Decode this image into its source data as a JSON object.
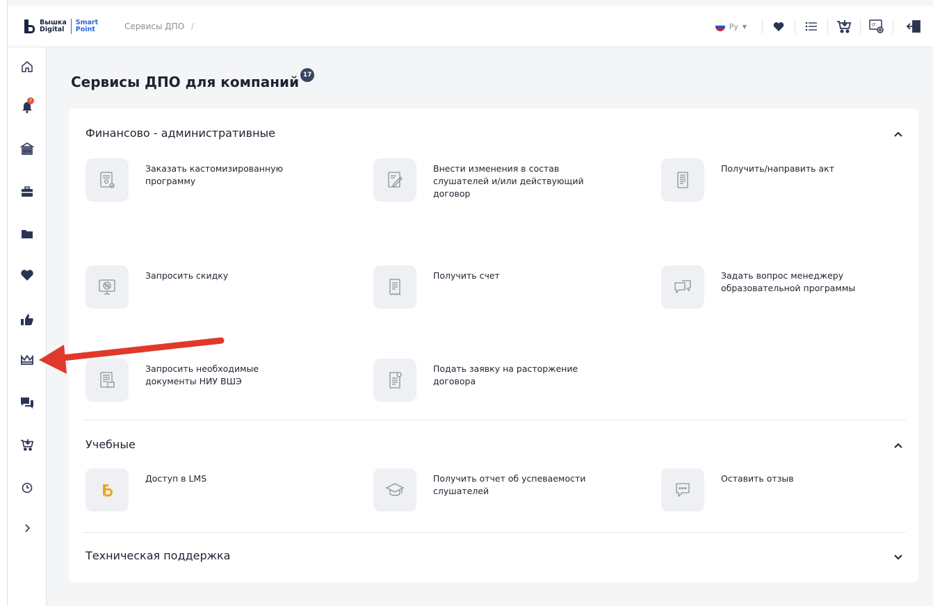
{
  "header": {
    "logo": {
      "line1": "Вышка",
      "line2": "Digital",
      "brand1": "Smart",
      "brand2": "Point"
    },
    "breadcrumb": {
      "current": "Сервисы ДПО",
      "separator": "/"
    },
    "language": "Ру",
    "icons": [
      "heart-icon",
      "list-icon",
      "cart-icon",
      "it-monitor-icon",
      "logout-icon"
    ]
  },
  "sidebar": {
    "notification_count": "2",
    "items": [
      "home-icon",
      "bell-icon",
      "university-icon",
      "briefcase-icon",
      "folder-icon",
      "heart-icon",
      "thumbs-up-icon",
      "crown-icon",
      "chat-icon",
      "cart-icon",
      "clock-icon",
      "expand-icon"
    ]
  },
  "page": {
    "title": "Сервисы ДПО для компаний",
    "count": "17"
  },
  "sections": [
    {
      "title": "Финансово - административные",
      "expanded": true,
      "services": [
        "Заказать кастомизированную программу",
        "Внести изменения в состав слушателей и/или действующий договор",
        "Получить/направить акт",
        "Запросить скидку",
        "Получить счет",
        "Задать вопрос менеджеру образовательной программы",
        "Запросить необходимые документы НИУ ВШЭ",
        "Подать заявку на расторжение договора"
      ]
    },
    {
      "title": "Учебные",
      "expanded": true,
      "services": [
        "Доступ в LMS",
        "Получить отчет об успеваемости слушателей",
        "Оставить отзыв"
      ]
    },
    {
      "title": "Техническая поддержка",
      "expanded": false,
      "services": []
    }
  ],
  "colors": {
    "accent_blue": "#2a66d6",
    "annotation_arrow": "#e0392b",
    "lms_orange": "#f0a020"
  }
}
